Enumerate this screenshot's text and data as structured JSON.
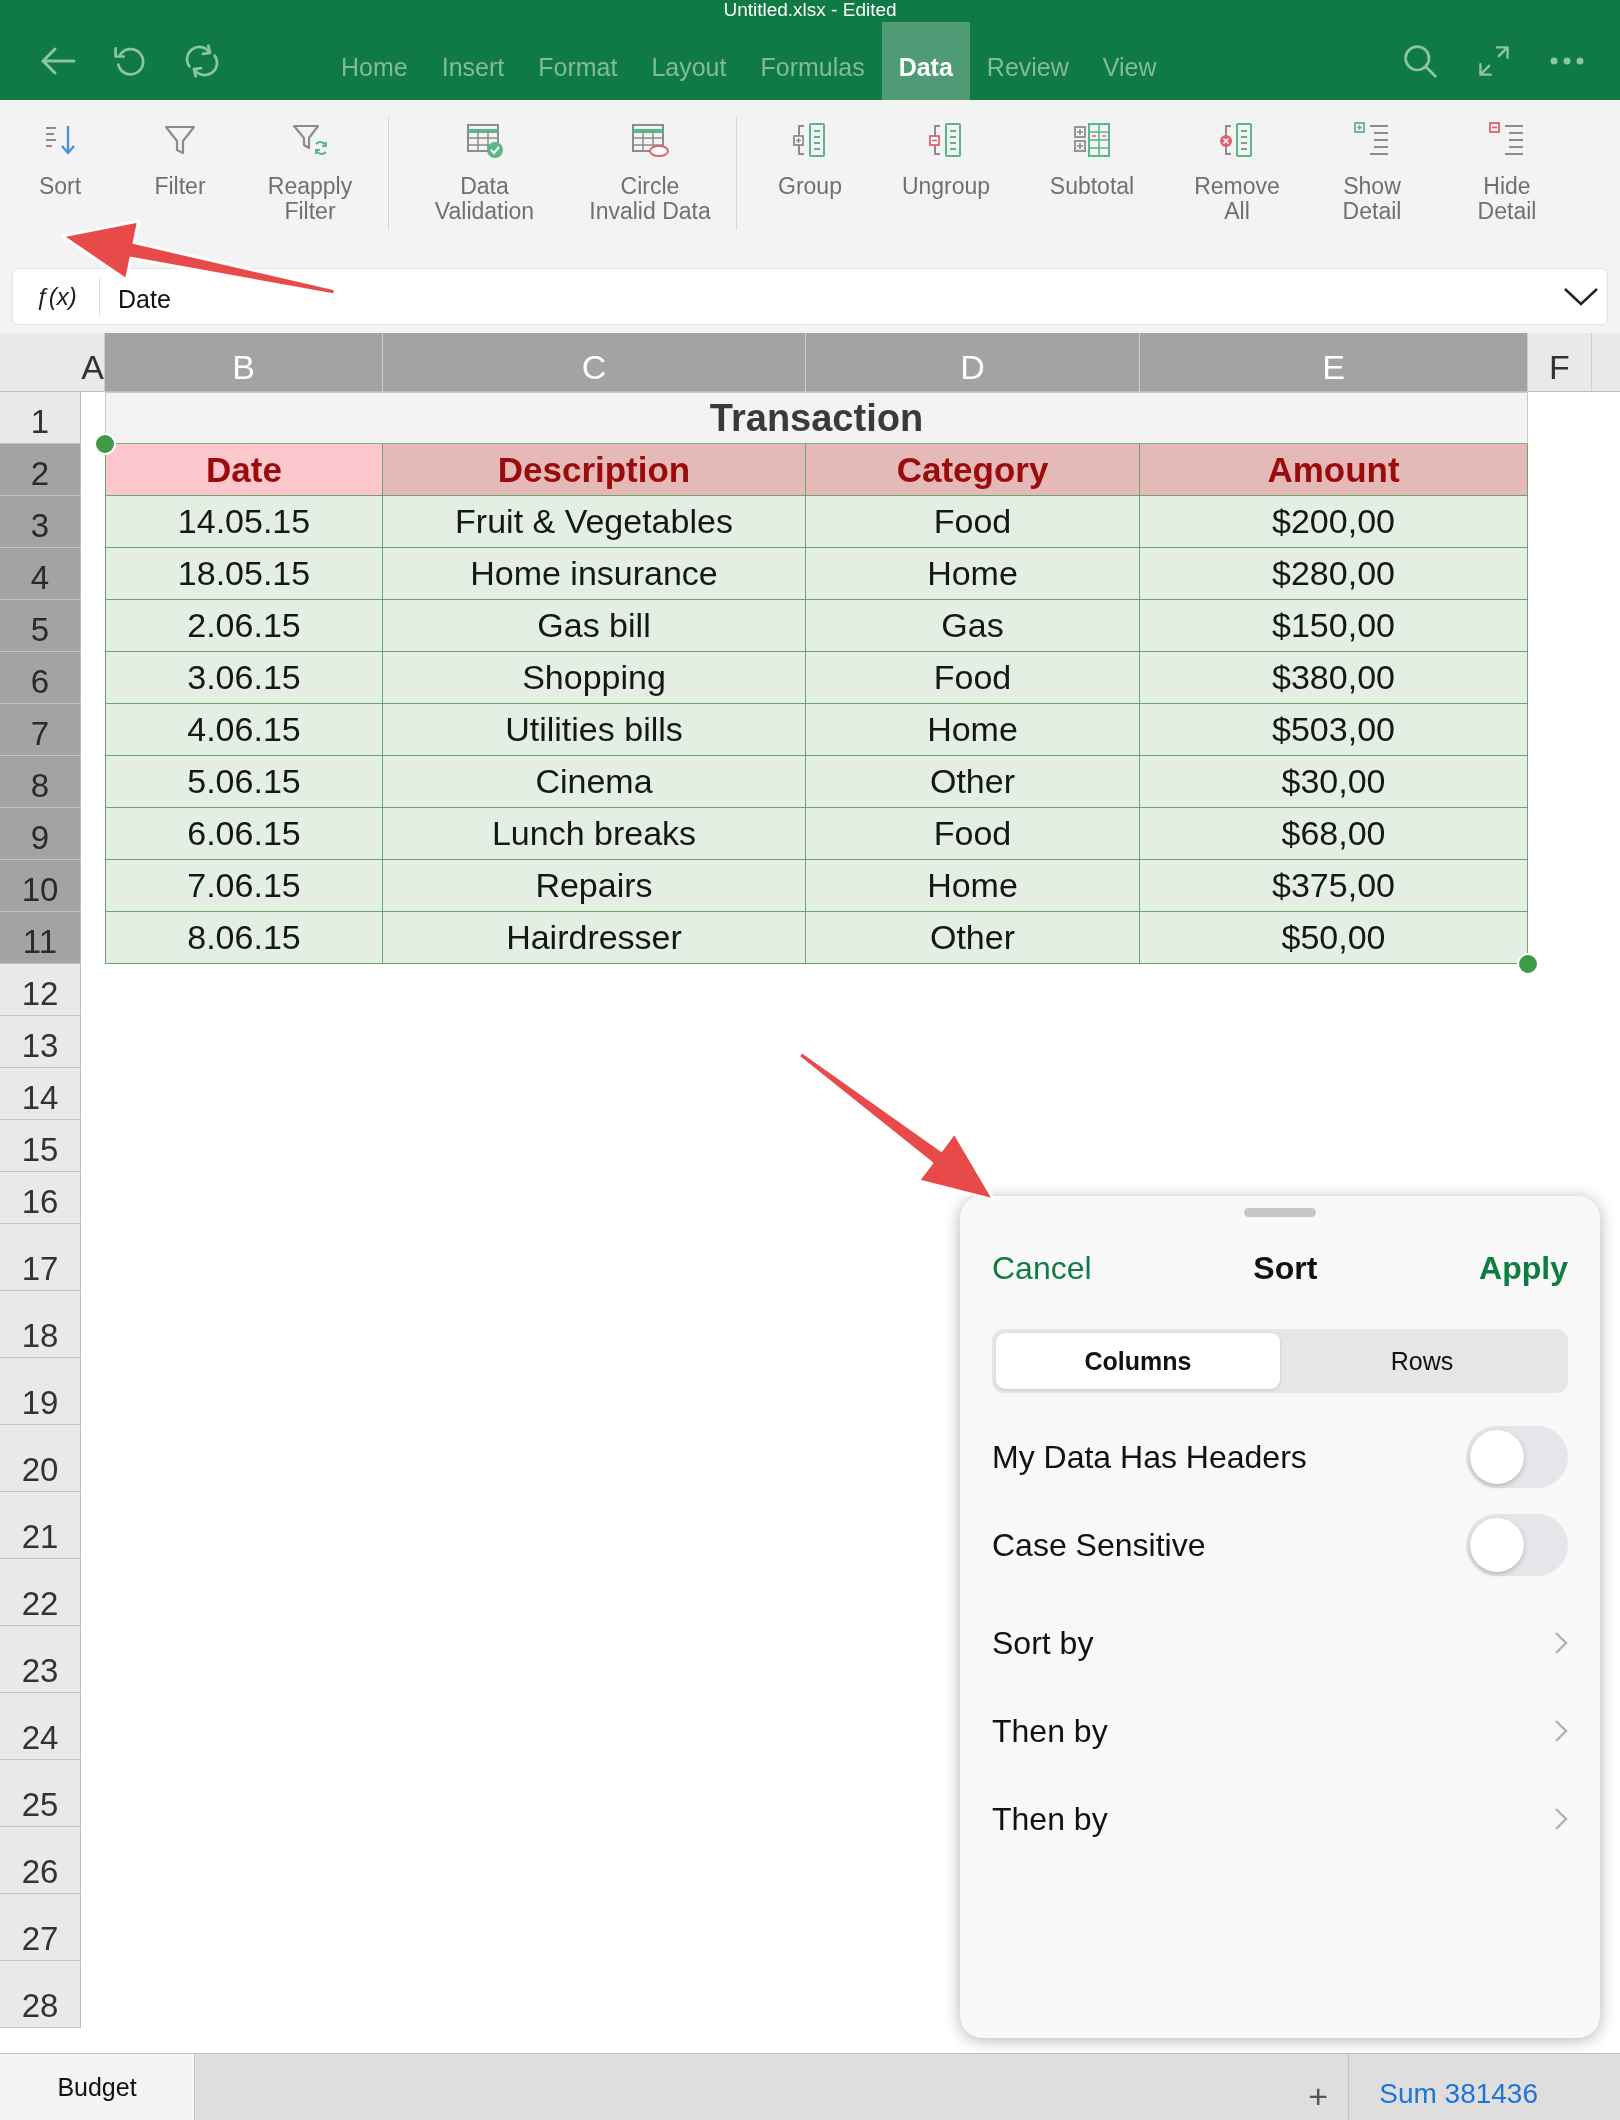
{
  "window": {
    "title": "Untitled.xlsx - Edited"
  },
  "menu_tabs": [
    {
      "label": "Home",
      "selected": false
    },
    {
      "label": "Insert",
      "selected": false
    },
    {
      "label": "Format",
      "selected": false
    },
    {
      "label": "Layout",
      "selected": false
    },
    {
      "label": "Formulas",
      "selected": false
    },
    {
      "label": "Data",
      "selected": true
    },
    {
      "label": "Review",
      "selected": false
    },
    {
      "label": "View",
      "selected": false
    }
  ],
  "ribbon": {
    "groups": [
      {
        "items": [
          {
            "label": "Sort"
          },
          {
            "label": "Filter"
          },
          {
            "label": "Reapply Filter"
          }
        ]
      },
      {
        "items": [
          {
            "label": "Data Validation"
          },
          {
            "label": "Circle Invalid Data"
          }
        ]
      },
      {
        "items": [
          {
            "label": "Group"
          },
          {
            "label": "Ungroup"
          },
          {
            "label": "Subtotal"
          },
          {
            "label": "Remove All"
          },
          {
            "label": "Show Detail"
          },
          {
            "label": "Hide Detail"
          }
        ]
      }
    ]
  },
  "formula_bar": {
    "function_label": "ƒ(x)",
    "value": "Date"
  },
  "sheet": {
    "columns": [
      {
        "label": "A",
        "selected": false
      },
      {
        "label": "B",
        "selected": true
      },
      {
        "label": "C",
        "selected": true
      },
      {
        "label": "D",
        "selected": true
      },
      {
        "label": "E",
        "selected": true
      },
      {
        "label": "F",
        "selected": false
      }
    ],
    "rows": [
      {
        "label": "1",
        "selected": false
      },
      {
        "label": "2",
        "selected": true
      },
      {
        "label": "3",
        "selected": true
      },
      {
        "label": "4",
        "selected": true
      },
      {
        "label": "5",
        "selected": true
      },
      {
        "label": "6",
        "selected": true
      },
      {
        "label": "7",
        "selected": true
      },
      {
        "label": "8",
        "selected": true
      },
      {
        "label": "9",
        "selected": true
      },
      {
        "label": "10",
        "selected": true
      },
      {
        "label": "11",
        "selected": true
      },
      {
        "label": "12",
        "selected": false
      },
      {
        "label": "13",
        "selected": false
      },
      {
        "label": "14",
        "selected": false
      },
      {
        "label": "15",
        "selected": false
      },
      {
        "label": "16",
        "selected": false
      },
      {
        "label": "17",
        "selected": false
      },
      {
        "label": "18",
        "selected": false
      },
      {
        "label": "19",
        "selected": false
      },
      {
        "label": "20",
        "selected": false
      },
      {
        "label": "21",
        "selected": false
      },
      {
        "label": "22",
        "selected": false
      },
      {
        "label": "23",
        "selected": false
      },
      {
        "label": "24",
        "selected": false
      },
      {
        "label": "25",
        "selected": false
      },
      {
        "label": "26",
        "selected": false
      },
      {
        "label": "27",
        "selected": false
      },
      {
        "label": "28",
        "selected": false
      }
    ],
    "table": {
      "title": "Transaction",
      "header": [
        {
          "text": "Date",
          "active": true
        },
        {
          "text": "Description",
          "active": false
        },
        {
          "text": "Category",
          "active": false
        },
        {
          "text": "Amount",
          "active": false
        }
      ],
      "rows": [
        [
          "14.05.15",
          "Fruit & Vegetables",
          "Food",
          "$200,00"
        ],
        [
          "18.05.15",
          "Home insurance",
          "Home",
          "$280,00"
        ],
        [
          "2.06.15",
          "Gas bill",
          "Gas",
          "$150,00"
        ],
        [
          "3.06.15",
          "Shopping",
          "Food",
          "$380,00"
        ],
        [
          "4.06.15",
          "Utilities bills",
          "Home",
          "$503,00"
        ],
        [
          "5.06.15",
          "Cinema",
          "Other",
          "$30,00"
        ],
        [
          "6.06.15",
          "Lunch breaks",
          "Food",
          "$68,00"
        ],
        [
          "7.06.15",
          "Repairs",
          "Home",
          "$375,00"
        ],
        [
          "8.06.15",
          "Hairdresser",
          "Other",
          "$50,00"
        ]
      ]
    }
  },
  "sheet_tabs": [
    {
      "label": "Budget",
      "selected": true
    }
  ],
  "add_sheet": "+",
  "status": "Sum 381436",
  "sort_panel": {
    "cancel": "Cancel",
    "title": "Sort",
    "apply": "Apply",
    "segments": [
      {
        "label": "Columns",
        "selected": true
      },
      {
        "label": "Rows",
        "selected": false
      }
    ],
    "toggles": [
      {
        "label": "My Data Has Headers",
        "on": false
      },
      {
        "label": "Case Sensitive",
        "on": false
      }
    ],
    "options": [
      {
        "label": "Sort by"
      },
      {
        "label": "Then by"
      },
      {
        "label": "Then by"
      }
    ]
  }
}
